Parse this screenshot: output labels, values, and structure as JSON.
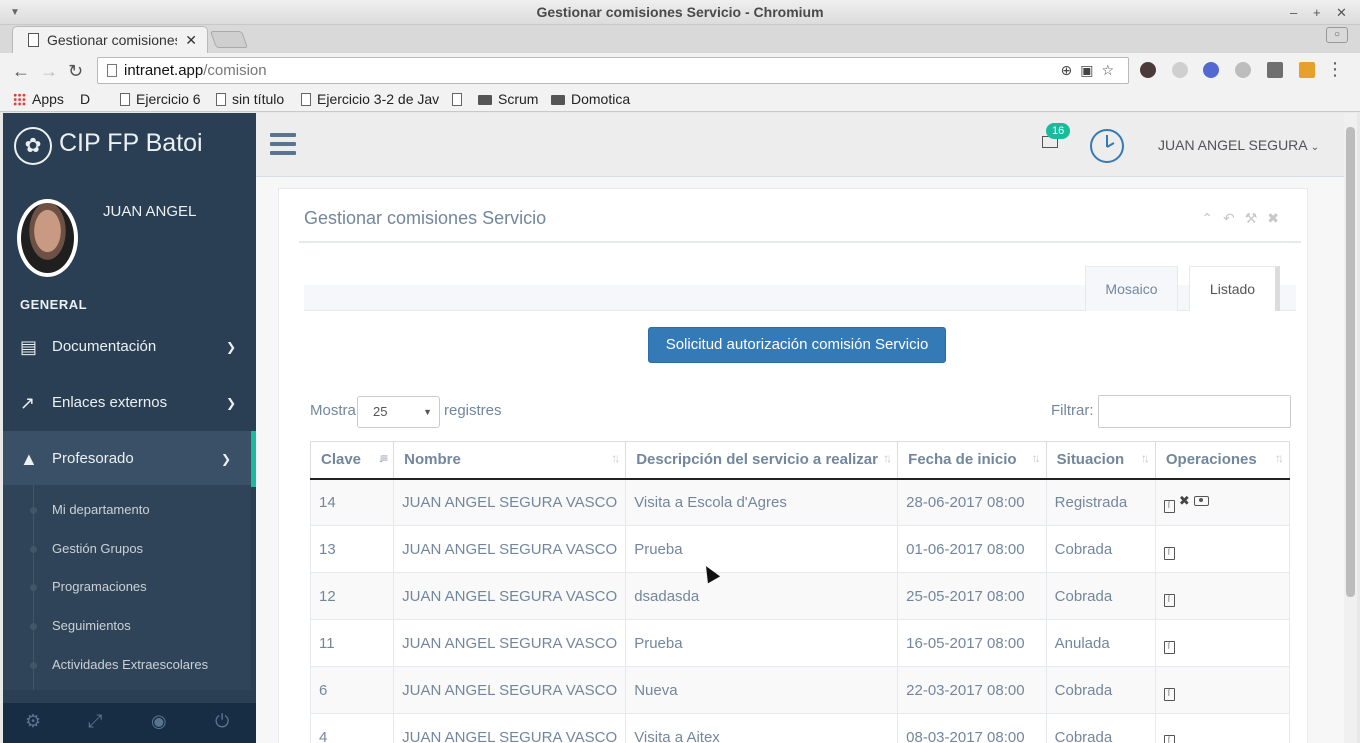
{
  "window": {
    "title": "Gestionar comisiones Servicio - Chromium"
  },
  "browser": {
    "tab_title": "Gestionar comisiones",
    "url_host": "intranet.app",
    "url_path": "/comision",
    "bookmarks": [
      "Apps",
      "D",
      "Ejercicio 6",
      "sin título",
      "Ejercicio 3-2 de Jav",
      "",
      "Scrum",
      "Domotica"
    ]
  },
  "sidebar": {
    "brand": "CIP FP Batoi",
    "user_name": "JUAN ANGEL",
    "section": "GENERAL",
    "menu": [
      {
        "label": "Documentación",
        "icon": "book-icon"
      },
      {
        "label": "Enlaces externos",
        "icon": "external-link-icon"
      },
      {
        "label": "Profesorado",
        "icon": "graduation-cap-icon"
      }
    ],
    "submenu": [
      "Mi departamento",
      "Gestión Grupos",
      "Programaciones",
      "Seguimientos",
      "Actividades Extraescolares"
    ]
  },
  "topnav": {
    "badge_count": "16",
    "user": "JUAN ANGEL SEGURA"
  },
  "panel": {
    "title": "Gestionar comisiones Servicio",
    "tabs": [
      "Mosaico",
      "Listado"
    ],
    "action_button": "Solicitud autorización comisión Servicio",
    "length_before": "Mostra",
    "length_value": "25",
    "length_after": "registres",
    "filter_label": "Filtrar:"
  },
  "table": {
    "headers": [
      "Clave",
      "Nombre",
      "Descripción del servicio a realizar",
      "Fecha de inicio",
      "Situacion",
      "Operaciones"
    ],
    "rows": [
      {
        "clave": "14",
        "nombre": "JUAN ANGEL SEGURA VASCO",
        "descripcion": "Visita a Escola d'Agres",
        "fecha": "28-06-2017 08:00",
        "situacion": "Registrada"
      },
      {
        "clave": "13",
        "nombre": "JUAN ANGEL SEGURA VASCO",
        "descripcion": "Prueba",
        "fecha": "01-06-2017 08:00",
        "situacion": "Cobrada"
      },
      {
        "clave": "12",
        "nombre": "JUAN ANGEL SEGURA VASCO",
        "descripcion": "dsadasda",
        "fecha": "25-05-2017 08:00",
        "situacion": "Cobrada"
      },
      {
        "clave": "11",
        "nombre": "JUAN ANGEL SEGURA VASCO",
        "descripcion": "Prueba",
        "fecha": "16-05-2017 08:00",
        "situacion": "Anulada"
      },
      {
        "clave": "6",
        "nombre": "JUAN ANGEL SEGURA VASCO",
        "descripcion": "Nueva",
        "fecha": "22-03-2017 08:00",
        "situacion": "Cobrada"
      },
      {
        "clave": "4",
        "nombre": "JUAN ANGEL SEGURA VASCO",
        "descripcion": "Visita a Aitex",
        "fecha": "08-03-2017 08:00",
        "situacion": "Cobrada"
      }
    ]
  }
}
